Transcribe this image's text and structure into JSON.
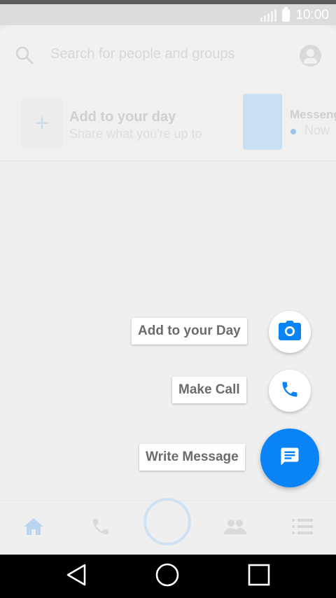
{
  "status_bar": {
    "time": "10:00",
    "icons": [
      "signal-icon",
      "battery-icon"
    ]
  },
  "search": {
    "placeholder": "Search for people and groups",
    "icon": "search-icon",
    "profile_icon": "profile-icon"
  },
  "day_row": {
    "add_title": "Add to your day",
    "add_subtitle": "Share what you're up to",
    "add_icon": "plus-icon",
    "story_name": "Messenger",
    "story_time": "Now"
  },
  "fab_menu": {
    "items": [
      {
        "label": "Add to your Day",
        "icon": "camera-icon"
      },
      {
        "label": "Make Call",
        "icon": "phone-icon"
      },
      {
        "label": "Write Message",
        "icon": "message-icon"
      }
    ]
  },
  "bottom_tabs": {
    "icons": [
      "home-icon",
      "phone-icon",
      "camera-capture-button",
      "people-icon",
      "list-icon"
    ]
  },
  "nav_bar": {
    "icons": [
      "back-icon",
      "home-circle-icon",
      "recents-icon"
    ]
  },
  "colors": {
    "accent": "#0a83f7",
    "status_bar": "#dcdcdc",
    "background": "#efefef",
    "nav_bar": "#000000"
  }
}
